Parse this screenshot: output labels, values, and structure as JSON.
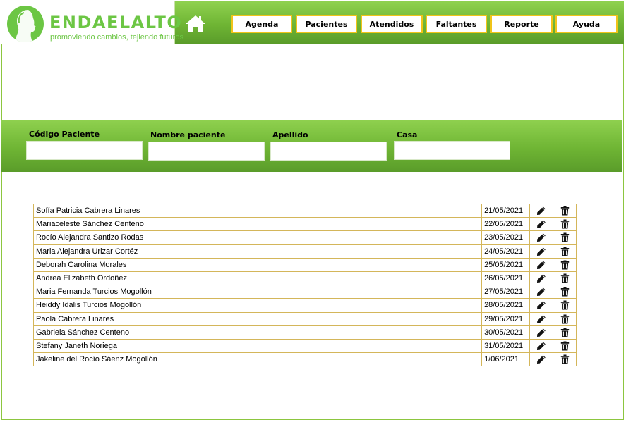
{
  "brand": {
    "name": "ENDAELALTO",
    "tagline": "promoviendo cambios, tejiendo futuros",
    "color": "#6cc644"
  },
  "nav": {
    "home_icon": "home-icon",
    "items": [
      {
        "label": "Agenda"
      },
      {
        "label": "Pacientes"
      },
      {
        "label": "Atendidos"
      },
      {
        "label": "Faltantes"
      },
      {
        "label": "Reporte"
      },
      {
        "label": "Ayuda"
      }
    ],
    "border_color": "#f0c419"
  },
  "search": {
    "codigo_label": "Código Paciente",
    "codigo_value": "",
    "nombre_label": "Nombre paciente",
    "nombre_value": "",
    "apellido_label": "Apellido",
    "apellido_value": "",
    "casa_label": "Casa",
    "casa_value": ""
  },
  "table": {
    "edit_icon": "pencil-icon",
    "delete_icon": "trash-icon",
    "rows": [
      {
        "name": "Sofía Patricia Cabrera Linares",
        "date": "21/05/2021"
      },
      {
        "name": "Mariaceleste Sánchez Centeno",
        "date": "22/05/2021"
      },
      {
        "name": "Rocío Alejandra Santizo Rodas",
        "date": "23/05/2021"
      },
      {
        "name": "Maria Alejandra Urizar Cortéz",
        "date": "24/05/2021"
      },
      {
        "name": "Deborah Carolina Morales",
        "date": "25/05/2021"
      },
      {
        "name": "Andrea Elizabeth Ordoñez",
        "date": "26/05/2021"
      },
      {
        "name": "Maria Fernanda Turcios Mogollón",
        "date": "27/05/2021"
      },
      {
        "name": "Heiddy Idalis Turcios Mogollón",
        "date": "28/05/2021"
      },
      {
        "name": "Paola Cabrera Linares",
        "date": "29/05/2021"
      },
      {
        "name": "Gabriela Sánchez Centeno",
        "date": "30/05/2021"
      },
      {
        "name": "Stefany Janeth Noriega",
        "date": "31/05/2021"
      },
      {
        "name": "Jakeline del Rocío Sáenz Mogollón",
        "date": "1/06/2021"
      }
    ]
  }
}
